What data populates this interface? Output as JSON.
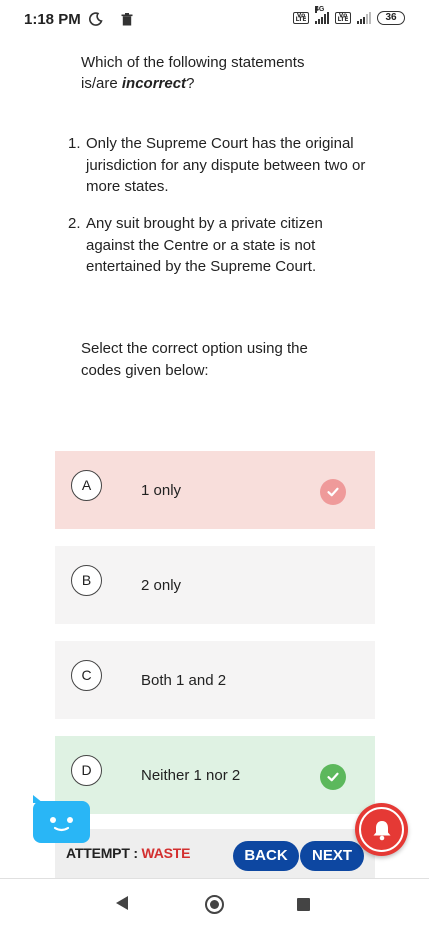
{
  "status_bar": {
    "time": "1:18 PM",
    "network_label": "4G",
    "volte_label": "Vo LTE",
    "battery": "36"
  },
  "question": {
    "prefix": "Which of the following statements is/are ",
    "emphasis": "incorrect",
    "suffix": "?"
  },
  "statements": [
    {
      "number": "1.",
      "text": "Only the Supreme Court has the original jurisdiction for any dispute between two or more states."
    },
    {
      "number": "2.",
      "text": "Any suit brought by a private citizen against the Centre or a state is not entertained by the Supreme Court."
    }
  ],
  "instruction": "Select the correct option using the codes given below:",
  "options": [
    {
      "letter": "A",
      "text": "1 only",
      "state": "wrong"
    },
    {
      "letter": "B",
      "text": "2 only",
      "state": "neutral"
    },
    {
      "letter": "C",
      "text": "Both 1 and 2",
      "state": "neutral"
    },
    {
      "letter": "D",
      "text": "Neither 1 nor 2",
      "state": "correct"
    }
  ],
  "footer": {
    "attempt_label": "ATTEMPT : ",
    "attempt_value": "WASTE",
    "back_label": "BACK",
    "next_label": "NEXT"
  },
  "icons": {
    "moon": "moon-icon",
    "trash": "trash-icon",
    "check": "check-icon",
    "bell": "bell-icon",
    "chat_bot": "chat-bot-icon"
  },
  "colors": {
    "wrong_bg": "#f8dedb",
    "correct_bg": "#dff2e3",
    "neutral_bg": "#f5f4f4",
    "button_blue": "#0d47a1",
    "waste_red": "#d32f2f",
    "check_pink": "#ef9a9a",
    "check_green": "#5cb85c",
    "bell_red": "#e53935",
    "bot_blue": "#29b6f6"
  }
}
